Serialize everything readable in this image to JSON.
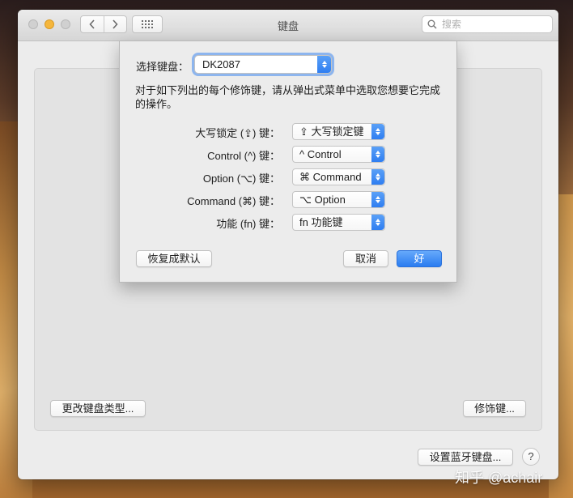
{
  "window": {
    "title": "键盘",
    "search_placeholder": "搜索"
  },
  "main": {
    "change_type_button": "更改键盘类型...",
    "modifier_keys_button": "修饰键...",
    "bluetooth_button": "设置蓝牙键盘...",
    "help_button": "?"
  },
  "sheet": {
    "select_keyboard_label": "选择键盘：",
    "selected_keyboard": "DK2087",
    "description": "对于如下列出的每个修饰键，请从弹出式菜单中选取您想要它完成的操作。",
    "rows": [
      {
        "label": "大写锁定 (⇪) 键：",
        "value": "⇪ 大写锁定键"
      },
      {
        "label": "Control (^) 键：",
        "value": "^ Control"
      },
      {
        "label": "Option (⌥) 键：",
        "value": "⌘ Command"
      },
      {
        "label": "Command (⌘) 键：",
        "value": "⌥ Option"
      },
      {
        "label": "功能 (fn) 键：",
        "value": "fn 功能键"
      }
    ],
    "restore_defaults_button": "恢复成默认",
    "cancel_button": "取消",
    "ok_button": "好"
  },
  "watermark": "知乎 @achair",
  "colors": {
    "accent": "#2f7ef1",
    "focus_ring": "#8db5ee"
  }
}
